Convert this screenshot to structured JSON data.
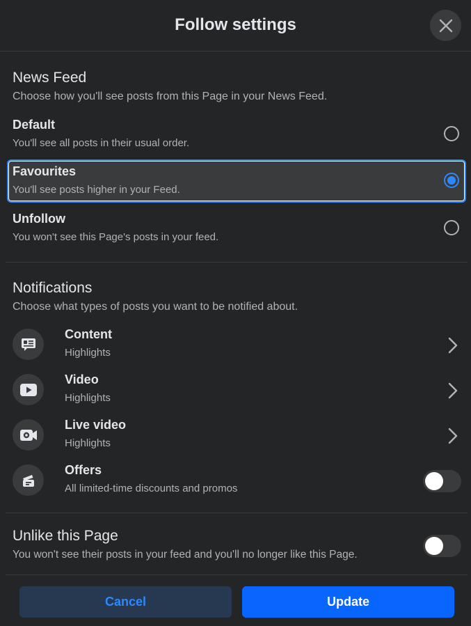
{
  "dialog": {
    "title": "Follow settings",
    "close_icon": "close-icon"
  },
  "news_feed": {
    "title": "News Feed",
    "subtitle": "Choose how you'll see posts from this Page in your News Feed.",
    "options": [
      {
        "label": "Default",
        "description": "You'll see all posts in their usual order.",
        "selected": false
      },
      {
        "label": "Favourites",
        "description": "You'll see posts higher in your Feed.",
        "selected": true
      },
      {
        "label": "Unfollow",
        "description": "You won't see this Page's posts in your feed.",
        "selected": false
      }
    ]
  },
  "notifications": {
    "title": "Notifications",
    "subtitle": "Choose what types of posts you want to be notified about.",
    "items": [
      {
        "label": "Content",
        "description": "Highlights",
        "icon": "content-icon",
        "control": "chevron"
      },
      {
        "label": "Video",
        "description": "Highlights",
        "icon": "video-icon",
        "control": "chevron"
      },
      {
        "label": "Live video",
        "description": "Highlights",
        "icon": "live-video-icon",
        "control": "chevron"
      },
      {
        "label": "Offers",
        "description": "All limited-time discounts and promos",
        "icon": "offers-icon",
        "control": "toggle",
        "on": false
      }
    ]
  },
  "unlike": {
    "title": "Unlike this Page",
    "description": "You won't see their posts in your feed and you'll no longer like this Page.",
    "on": false
  },
  "footer": {
    "cancel_label": "Cancel",
    "update_label": "Update"
  },
  "colors": {
    "background": "#242526",
    "accent": "#2d88ff",
    "primary_button": "#0866ff",
    "secondary_button": "#263951"
  }
}
